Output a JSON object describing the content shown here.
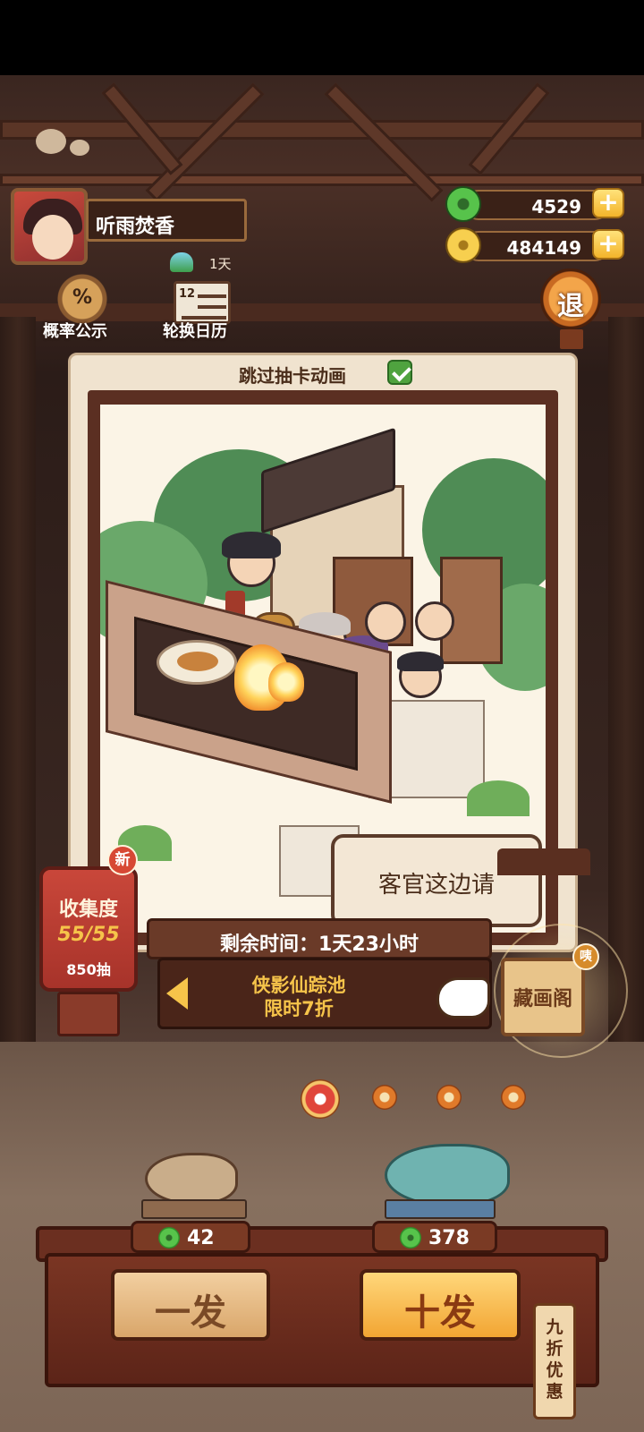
{
  "player": {
    "name": "听雨焚香",
    "days": "1天"
  },
  "currencies": {
    "jade": "4529",
    "coins": "484149"
  },
  "top_icons": {
    "probability_label": "概率公示",
    "probability_symbol": "%",
    "calendar_label": "轮换日历",
    "calendar_num": "12",
    "exit_label": "退"
  },
  "card": {
    "skip_animation_label": "跳过抽卡动画",
    "skip_checked": true
  },
  "bubble": {
    "text": "客官这边请"
  },
  "collection": {
    "title": "收集度",
    "progress": "55/55",
    "draws": "850抽",
    "new_badge": "新"
  },
  "pool": {
    "timer": "剩余时间：1天23小时",
    "name_line1": "侠影仙踪池",
    "name_line2": "限时7折"
  },
  "library": {
    "label": "藏画阁",
    "badge": "咦"
  },
  "pagination": {
    "count": 4,
    "active_index": 0
  },
  "draw": {
    "single_cost": "42",
    "ten_cost": "378",
    "single_label": "一发",
    "ten_label": "十发",
    "discount_tag": "九\n折\n优\n惠"
  },
  "colors": {
    "accent_gold": "#f6c44a",
    "wood_dark": "#3a2117",
    "jade_green": "#57c34b"
  }
}
